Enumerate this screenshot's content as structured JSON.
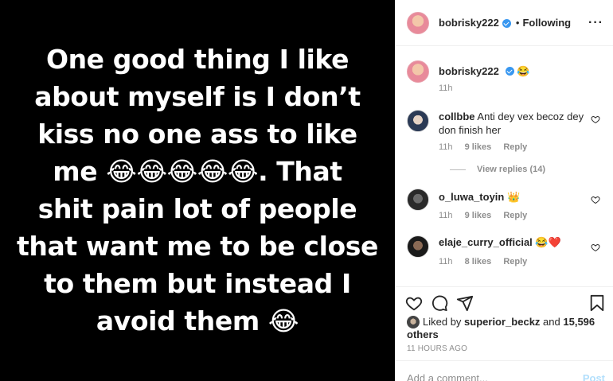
{
  "post": {
    "text_lines": [
      "One good thing I like",
      "about myself is I don’t",
      "kiss no one ass to like",
      "me 😂😂😂😂😂. That",
      "shit pain lot of people",
      "that want me to be close",
      "to them but instead I",
      "avoid them 😂"
    ]
  },
  "header": {
    "username": "bobrisky222",
    "separator": "•",
    "follow_status": "Following",
    "more": "···"
  },
  "caption": {
    "username": "bobrisky222",
    "text": "😂",
    "time": "11h"
  },
  "comments": [
    {
      "username": "collbbe",
      "text": "Anti dey vex becoz dey don finish her",
      "time": "11h",
      "likes": "9 likes",
      "reply": "Reply",
      "view_replies": "View replies (14)"
    },
    {
      "username": "o_luwa_toyin",
      "text": "👑",
      "time": "11h",
      "likes": "9 likes",
      "reply": "Reply"
    },
    {
      "username": "elaje_curry_official",
      "text": "😂❤️",
      "time": "11h",
      "likes": "8 likes",
      "reply": "Reply"
    }
  ],
  "likes": {
    "prefix": "Liked by",
    "user": "superior_beckz",
    "and": "and",
    "others": "15,596 others"
  },
  "timestamp": "11 HOURS AGO",
  "add_comment": {
    "placeholder": "Add a comment...",
    "post_label": "Post"
  },
  "colors": {
    "verified": "#3897f0",
    "muted": "#8e8e8e",
    "post_disabled": "#b2dffc"
  }
}
